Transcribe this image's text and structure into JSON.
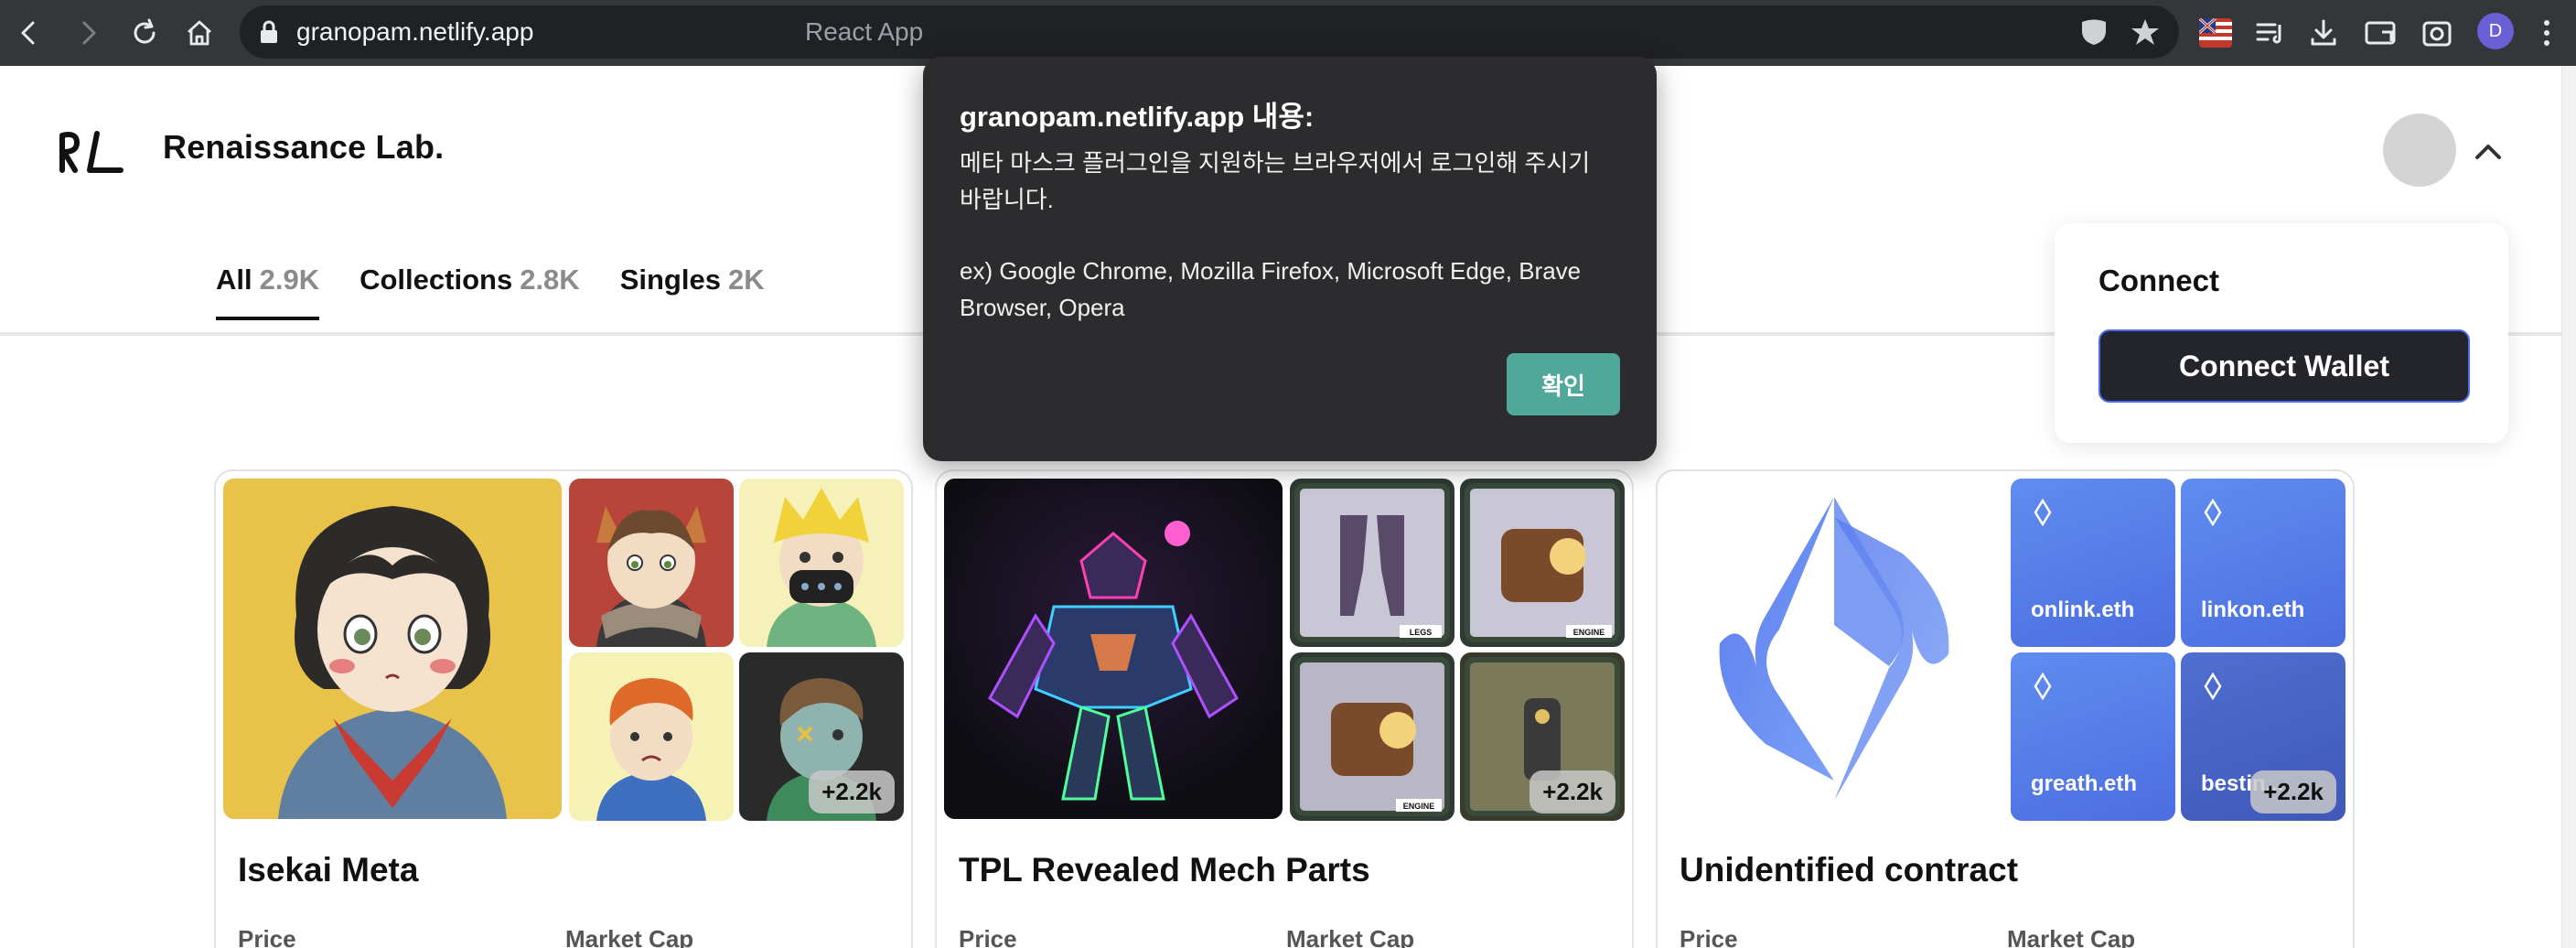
{
  "browser": {
    "host": "granopam.netlify.app",
    "page_title": "React App",
    "profile_initial": "D"
  },
  "site": {
    "brand_name": "Renaissance Lab."
  },
  "tabs": [
    {
      "label": "All",
      "count": "2.9K"
    },
    {
      "label": "Collections",
      "count": "2.8K"
    },
    {
      "label": "Singles",
      "count": "2K"
    }
  ],
  "cards": [
    {
      "title": "Isekai Meta",
      "more": "+2.2k",
      "price_label": "Price",
      "market_cap_label": "Market Cap"
    },
    {
      "title": "TPL Revealed Mech Parts",
      "more": "+2.2k",
      "price_label": "Price",
      "market_cap_label": "Market Cap"
    },
    {
      "title": "Unidentified contract",
      "more": "+2.2k",
      "price_label": "Price",
      "market_cap_label": "Market Cap",
      "ens_names": [
        "onlink.eth",
        "linkon.eth",
        "greath.eth",
        "bestin..."
      ]
    }
  ],
  "mech_badges": [
    "LEGS",
    "ENGINE",
    "ENGINE"
  ],
  "connect": {
    "title": "Connect",
    "button_label": "Connect Wallet"
  },
  "alert": {
    "title": "granopam.netlify.app 내용:",
    "message": "메타 마스크 플러그인을 지원하는 브라우저에서 로그인해 주시기 바랍니다.",
    "examples": " ex) Google Chrome, Mozilla Firefox, Microsoft Edge, Brave Browser, Opera",
    "ok_label": "확인"
  },
  "colors": {
    "accent_teal": "#4fa899",
    "ens_blue": "#5f8df0",
    "dark_button": "#23252b"
  }
}
